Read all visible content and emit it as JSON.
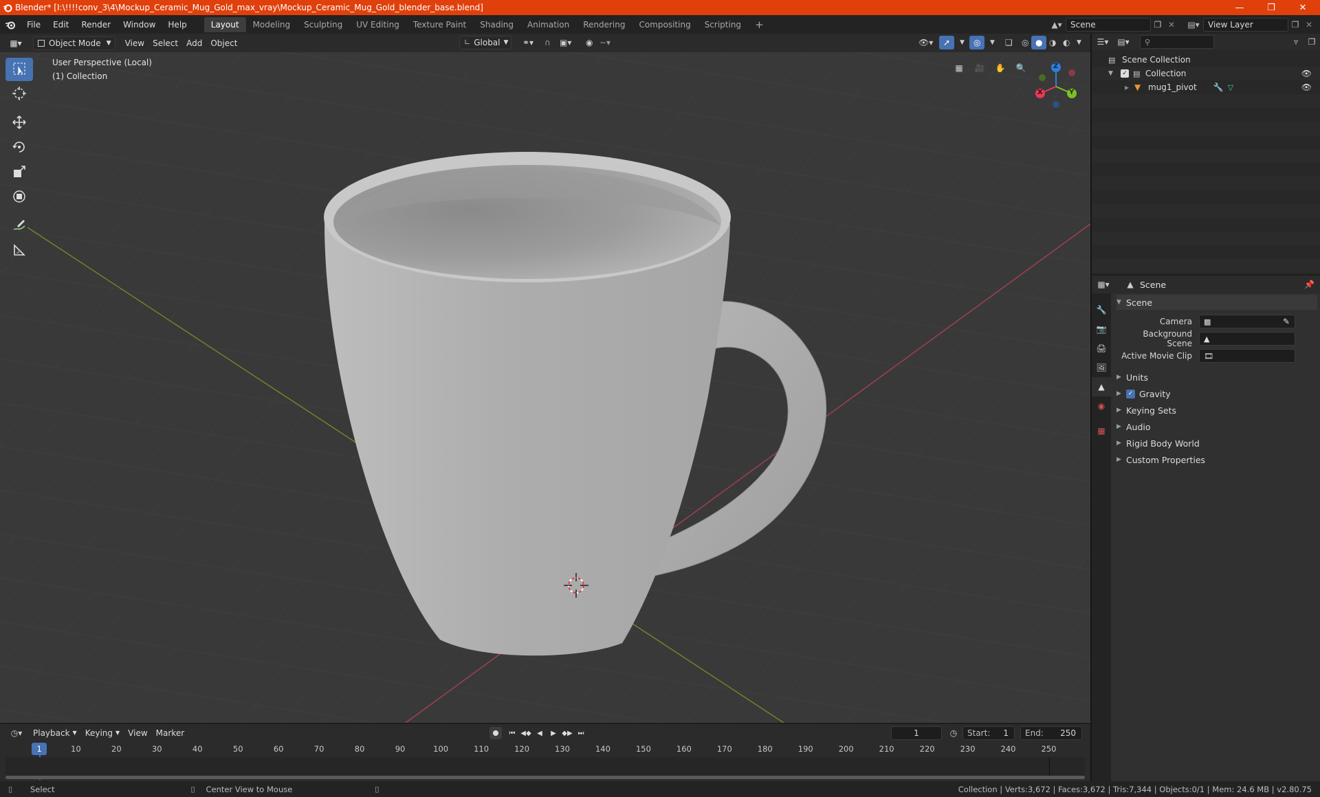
{
  "window": {
    "title": "Blender* [I:\\!!!!conv_3\\4\\Mockup_Ceramic_Mug_Gold_max_vray\\Mockup_Ceramic_Mug_Gold_blender_base.blend]",
    "accent": "#e0400c"
  },
  "menu": {
    "items": [
      "File",
      "Edit",
      "Render",
      "Window",
      "Help"
    ]
  },
  "workspaces": [
    "Layout",
    "Modeling",
    "Sculpting",
    "UV Editing",
    "Texture Paint",
    "Shading",
    "Animation",
    "Rendering",
    "Compositing",
    "Scripting"
  ],
  "workspace_active": "Layout",
  "scene_selector": {
    "scene": "Scene",
    "view_layer": "View Layer"
  },
  "viewport_header": {
    "mode": "Object Mode",
    "menus": [
      "View",
      "Select",
      "Add",
      "Object"
    ],
    "orientation": "Global"
  },
  "viewport": {
    "perspective_label": "User Perspective (Local)",
    "collection_label": "(1) Collection",
    "gizmo": {
      "z": "Z",
      "y": "Y",
      "x": "X"
    }
  },
  "outliner": {
    "root": "Scene Collection",
    "collection": "Collection",
    "object": "mug1_pivot"
  },
  "properties": {
    "tab_title": "Scene",
    "panel_title": "Scene",
    "fields": {
      "camera_label": "Camera",
      "background_scene_label": "Background Scene",
      "active_movie_clip_label": "Active Movie Clip"
    },
    "panels": [
      "Units",
      "Gravity",
      "Keying Sets",
      "Audio",
      "Rigid Body World",
      "Custom Properties"
    ],
    "gravity_checked": true
  },
  "timeline": {
    "menus": [
      "Playback",
      "Keying",
      "View",
      "Marker"
    ],
    "current_frame": "1",
    "start_label": "Start:",
    "start_value": "1",
    "end_label": "End:",
    "end_value": "250",
    "ticks": [
      "1",
      "10",
      "20",
      "30",
      "40",
      "50",
      "60",
      "70",
      "80",
      "90",
      "100",
      "110",
      "120",
      "130",
      "140",
      "150",
      "160",
      "170",
      "180",
      "190",
      "200",
      "210",
      "220",
      "230",
      "240",
      "250"
    ]
  },
  "statusbar": {
    "select": "Select",
    "center_view": "Center View to Mouse",
    "stats": "Collection | Verts:3,672 | Faces:3,672 | Tris:7,344 | Objects:0/1 | Mem: 24.6 MB | v2.80.75"
  }
}
